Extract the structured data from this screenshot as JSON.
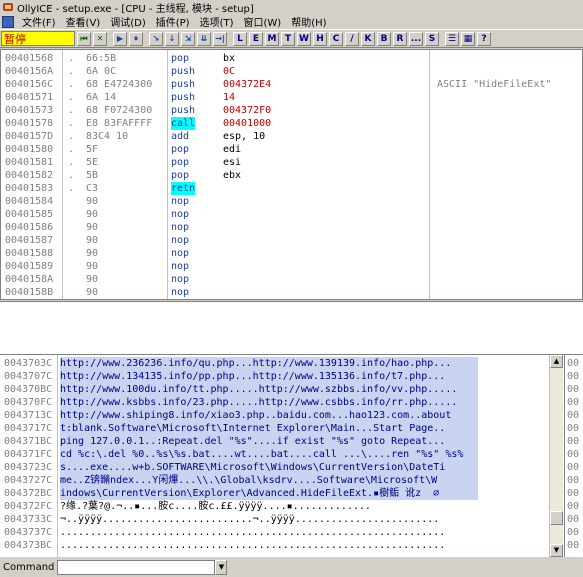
{
  "window": {
    "title": "OllyICE - setup.exe - [CPU - 主线程, 模块 - setup]"
  },
  "menu": [
    "文件(F)",
    "查看(V)",
    "调试(D)",
    "插件(P)",
    "选项(T)",
    "窗口(W)",
    "帮助(H)"
  ],
  "toolbar": {
    "status": "暂停",
    "play_buttons": [
      "⏮",
      "✕",
      "▶",
      "⏸",
      "↘",
      "↓",
      "⇲",
      "⇊",
      "→|"
    ],
    "letter_buttons": [
      "L",
      "E",
      "M",
      "T",
      "W",
      "H",
      "C",
      "/",
      "K",
      "B",
      "R",
      "...",
      "S"
    ]
  },
  "cpu": {
    "rows": [
      {
        "addr": "00401568",
        "jmp": ".",
        "hex": "66:5B",
        "mn": "pop",
        "op": "bx",
        "cmt": "",
        "hl": false
      },
      {
        "addr": "0040156A",
        "jmp": ".",
        "hex": "6A 0C",
        "mn": "push",
        "op": "0C",
        "cmt": "",
        "hl": false,
        "red": true
      },
      {
        "addr": "0040156C",
        "jmp": ".",
        "hex": "68 E4724300",
        "mn": "push",
        "op": "004372E4",
        "cmt": "ASCII \"HideFileExt\"",
        "hl": false,
        "red": true
      },
      {
        "addr": "00401571",
        "jmp": ".",
        "hex": "6A 14",
        "mn": "push",
        "op": "14",
        "cmt": "",
        "hl": false,
        "red": true
      },
      {
        "addr": "00401573",
        "jmp": ".",
        "hex": "68 F0724300",
        "mn": "push",
        "op": "004372F0",
        "cmt": "",
        "hl": false,
        "red": true
      },
      {
        "addr": "00401578",
        "jmp": ".",
        "hex": "E8 83FAFFFF",
        "mn": "call",
        "op": "00401000",
        "cmt": "",
        "hl": true,
        "red": true
      },
      {
        "addr": "0040157D",
        "jmp": ".",
        "hex": "83C4 10",
        "mn": "add",
        "op": "esp, 10",
        "cmt": "",
        "hl": false
      },
      {
        "addr": "00401580",
        "jmp": ".",
        "hex": "5F",
        "mn": "pop",
        "op": "edi",
        "cmt": "",
        "hl": false
      },
      {
        "addr": "00401581",
        "jmp": ".",
        "hex": "5E",
        "mn": "pop",
        "op": "esi",
        "cmt": "",
        "hl": false
      },
      {
        "addr": "00401582",
        "jmp": ".",
        "hex": "5B",
        "mn": "pop",
        "op": "ebx",
        "cmt": "",
        "hl": false
      },
      {
        "addr": "00401583",
        "jmp": ".",
        "hex": "C3",
        "mn": "retn",
        "op": "",
        "cmt": "",
        "hl": true
      },
      {
        "addr": "00401584",
        "jmp": "",
        "hex": "90",
        "mn": "nop",
        "op": "",
        "cmt": "",
        "hl": false
      },
      {
        "addr": "00401585",
        "jmp": "",
        "hex": "90",
        "mn": "nop",
        "op": "",
        "cmt": "",
        "hl": false
      },
      {
        "addr": "00401586",
        "jmp": "",
        "hex": "90",
        "mn": "nop",
        "op": "",
        "cmt": "",
        "hl": false
      },
      {
        "addr": "00401587",
        "jmp": "",
        "hex": "90",
        "mn": "nop",
        "op": "",
        "cmt": "",
        "hl": false
      },
      {
        "addr": "00401588",
        "jmp": "",
        "hex": "90",
        "mn": "nop",
        "op": "",
        "cmt": "",
        "hl": false
      },
      {
        "addr": "00401589",
        "jmp": "",
        "hex": "90",
        "mn": "nop",
        "op": "",
        "cmt": "",
        "hl": false
      },
      {
        "addr": "0040158A",
        "jmp": "",
        "hex": "90",
        "mn": "nop",
        "op": "",
        "cmt": "",
        "hl": false
      },
      {
        "addr": "0040158B",
        "jmp": "",
        "hex": "90",
        "mn": "nop",
        "op": "",
        "cmt": "",
        "hl": false
      }
    ]
  },
  "dump": {
    "rows": [
      {
        "addr": "0043703C",
        "text": "http://www.236236.info/qu.php...http://www.139139.info/hao.php...",
        "sel": true
      },
      {
        "addr": "0043707C",
        "text": "http://www.134135.info/pp.php...http://www.135136.info/t7.php...",
        "sel": true
      },
      {
        "addr": "004370BC",
        "text": "http://www.100du.info/tt.php.....http://www.szbbs.info/vv.php.....",
        "sel": true
      },
      {
        "addr": "004370FC",
        "text": "http://www.ksbbs.info/23.php.....http://www.csbbs.info/rr.php.....",
        "sel": true
      },
      {
        "addr": "0043713C",
        "text": "http://www.shiping8.info/xiao3.php..baidu.com...hao123.com..about",
        "sel": true
      },
      {
        "addr": "0043717C",
        "text": "t:blank.Software\\Microsoft\\Internet Explorer\\Main...Start Page..",
        "sel": true
      },
      {
        "addr": "004371BC",
        "text": "ping 127.0.0.1..:Repeat.del \"%s\"....if exist \"%s\" goto Repeat...",
        "sel": true
      },
      {
        "addr": "004371FC",
        "text": "cd %c:\\.del %0..%s\\%s.bat....wt....bat....call ...\\....ren \"%s\" %s%",
        "sel": true
      },
      {
        "addr": "0043723C",
        "text": "s....exe....w+b.SOFTWARE\\Microsoft\\Windows\\CurrentVersion\\DateTi",
        "sel": true
      },
      {
        "addr": "0043727C",
        "text": "me..Z锛鏅ndex...Y闲熚...\\\\.\\Global\\ksdrv....Software\\Microsoft\\W",
        "sel": true
      },
      {
        "addr": "004372BC",
        "text": "indows\\CurrentVersion\\Explorer\\Advanced.HideFileExt.▪樹鲘 讹z  ∅",
        "sel": true
      },
      {
        "addr": "004372FC",
        "text": "?缘.?葉?@.¬..▪...胺c....胺c.££.ÿÿÿÿ....▪.............",
        "sel": false
      },
      {
        "addr": "0043733C",
        "text": "¬..ÿÿÿÿ.........................¬..ÿÿÿÿ........................",
        "sel": false
      },
      {
        "addr": "0043737C",
        "text": "................................................................",
        "sel": false
      },
      {
        "addr": "004373BC",
        "text": "................................................................",
        "sel": false
      }
    ]
  },
  "stack": [
    "00",
    "00",
    "00",
    "00",
    "00",
    "00",
    "00",
    "00",
    "00",
    "00",
    "00",
    "00",
    "00",
    "00",
    "00"
  ],
  "command": {
    "label": "Command",
    "value": ""
  }
}
